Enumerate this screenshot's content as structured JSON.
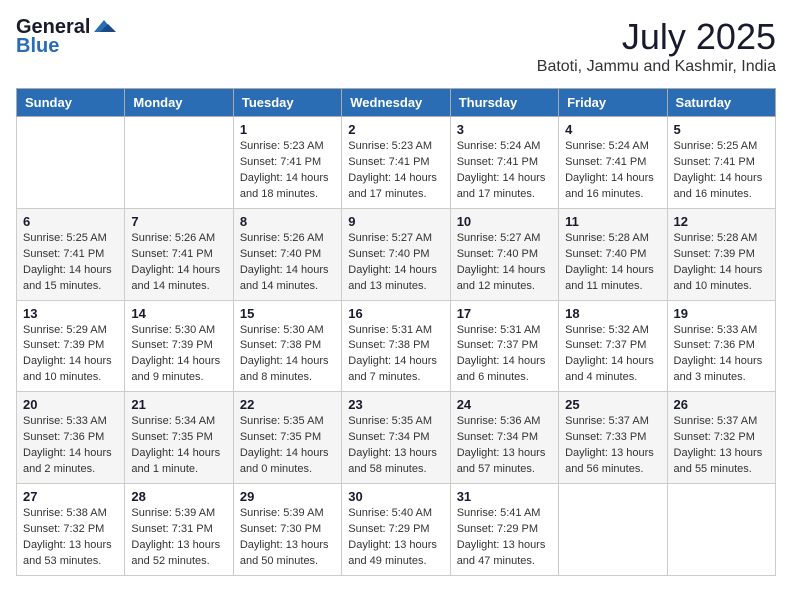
{
  "header": {
    "logo_general": "General",
    "logo_blue": "Blue",
    "month": "July 2025",
    "location": "Batoti, Jammu and Kashmir, India"
  },
  "days_of_week": [
    "Sunday",
    "Monday",
    "Tuesday",
    "Wednesday",
    "Thursday",
    "Friday",
    "Saturday"
  ],
  "weeks": [
    [
      {
        "day": "",
        "sunrise": "",
        "sunset": "",
        "daylight": ""
      },
      {
        "day": "",
        "sunrise": "",
        "sunset": "",
        "daylight": ""
      },
      {
        "day": "1",
        "sunrise": "Sunrise: 5:23 AM",
        "sunset": "Sunset: 7:41 PM",
        "daylight": "Daylight: 14 hours and 18 minutes."
      },
      {
        "day": "2",
        "sunrise": "Sunrise: 5:23 AM",
        "sunset": "Sunset: 7:41 PM",
        "daylight": "Daylight: 14 hours and 17 minutes."
      },
      {
        "day": "3",
        "sunrise": "Sunrise: 5:24 AM",
        "sunset": "Sunset: 7:41 PM",
        "daylight": "Daylight: 14 hours and 17 minutes."
      },
      {
        "day": "4",
        "sunrise": "Sunrise: 5:24 AM",
        "sunset": "Sunset: 7:41 PM",
        "daylight": "Daylight: 14 hours and 16 minutes."
      },
      {
        "day": "5",
        "sunrise": "Sunrise: 5:25 AM",
        "sunset": "Sunset: 7:41 PM",
        "daylight": "Daylight: 14 hours and 16 minutes."
      }
    ],
    [
      {
        "day": "6",
        "sunrise": "Sunrise: 5:25 AM",
        "sunset": "Sunset: 7:41 PM",
        "daylight": "Daylight: 14 hours and 15 minutes."
      },
      {
        "day": "7",
        "sunrise": "Sunrise: 5:26 AM",
        "sunset": "Sunset: 7:41 PM",
        "daylight": "Daylight: 14 hours and 14 minutes."
      },
      {
        "day": "8",
        "sunrise": "Sunrise: 5:26 AM",
        "sunset": "Sunset: 7:40 PM",
        "daylight": "Daylight: 14 hours and 14 minutes."
      },
      {
        "day": "9",
        "sunrise": "Sunrise: 5:27 AM",
        "sunset": "Sunset: 7:40 PM",
        "daylight": "Daylight: 14 hours and 13 minutes."
      },
      {
        "day": "10",
        "sunrise": "Sunrise: 5:27 AM",
        "sunset": "Sunset: 7:40 PM",
        "daylight": "Daylight: 14 hours and 12 minutes."
      },
      {
        "day": "11",
        "sunrise": "Sunrise: 5:28 AM",
        "sunset": "Sunset: 7:40 PM",
        "daylight": "Daylight: 14 hours and 11 minutes."
      },
      {
        "day": "12",
        "sunrise": "Sunrise: 5:28 AM",
        "sunset": "Sunset: 7:39 PM",
        "daylight": "Daylight: 14 hours and 10 minutes."
      }
    ],
    [
      {
        "day": "13",
        "sunrise": "Sunrise: 5:29 AM",
        "sunset": "Sunset: 7:39 PM",
        "daylight": "Daylight: 14 hours and 10 minutes."
      },
      {
        "day": "14",
        "sunrise": "Sunrise: 5:30 AM",
        "sunset": "Sunset: 7:39 PM",
        "daylight": "Daylight: 14 hours and 9 minutes."
      },
      {
        "day": "15",
        "sunrise": "Sunrise: 5:30 AM",
        "sunset": "Sunset: 7:38 PM",
        "daylight": "Daylight: 14 hours and 8 minutes."
      },
      {
        "day": "16",
        "sunrise": "Sunrise: 5:31 AM",
        "sunset": "Sunset: 7:38 PM",
        "daylight": "Daylight: 14 hours and 7 minutes."
      },
      {
        "day": "17",
        "sunrise": "Sunrise: 5:31 AM",
        "sunset": "Sunset: 7:37 PM",
        "daylight": "Daylight: 14 hours and 6 minutes."
      },
      {
        "day": "18",
        "sunrise": "Sunrise: 5:32 AM",
        "sunset": "Sunset: 7:37 PM",
        "daylight": "Daylight: 14 hours and 4 minutes."
      },
      {
        "day": "19",
        "sunrise": "Sunrise: 5:33 AM",
        "sunset": "Sunset: 7:36 PM",
        "daylight": "Daylight: 14 hours and 3 minutes."
      }
    ],
    [
      {
        "day": "20",
        "sunrise": "Sunrise: 5:33 AM",
        "sunset": "Sunset: 7:36 PM",
        "daylight": "Daylight: 14 hours and 2 minutes."
      },
      {
        "day": "21",
        "sunrise": "Sunrise: 5:34 AM",
        "sunset": "Sunset: 7:35 PM",
        "daylight": "Daylight: 14 hours and 1 minute."
      },
      {
        "day": "22",
        "sunrise": "Sunrise: 5:35 AM",
        "sunset": "Sunset: 7:35 PM",
        "daylight": "Daylight: 14 hours and 0 minutes."
      },
      {
        "day": "23",
        "sunrise": "Sunrise: 5:35 AM",
        "sunset": "Sunset: 7:34 PM",
        "daylight": "Daylight: 13 hours and 58 minutes."
      },
      {
        "day": "24",
        "sunrise": "Sunrise: 5:36 AM",
        "sunset": "Sunset: 7:34 PM",
        "daylight": "Daylight: 13 hours and 57 minutes."
      },
      {
        "day": "25",
        "sunrise": "Sunrise: 5:37 AM",
        "sunset": "Sunset: 7:33 PM",
        "daylight": "Daylight: 13 hours and 56 minutes."
      },
      {
        "day": "26",
        "sunrise": "Sunrise: 5:37 AM",
        "sunset": "Sunset: 7:32 PM",
        "daylight": "Daylight: 13 hours and 55 minutes."
      }
    ],
    [
      {
        "day": "27",
        "sunrise": "Sunrise: 5:38 AM",
        "sunset": "Sunset: 7:32 PM",
        "daylight": "Daylight: 13 hours and 53 minutes."
      },
      {
        "day": "28",
        "sunrise": "Sunrise: 5:39 AM",
        "sunset": "Sunset: 7:31 PM",
        "daylight": "Daylight: 13 hours and 52 minutes."
      },
      {
        "day": "29",
        "sunrise": "Sunrise: 5:39 AM",
        "sunset": "Sunset: 7:30 PM",
        "daylight": "Daylight: 13 hours and 50 minutes."
      },
      {
        "day": "30",
        "sunrise": "Sunrise: 5:40 AM",
        "sunset": "Sunset: 7:29 PM",
        "daylight": "Daylight: 13 hours and 49 minutes."
      },
      {
        "day": "31",
        "sunrise": "Sunrise: 5:41 AM",
        "sunset": "Sunset: 7:29 PM",
        "daylight": "Daylight: 13 hours and 47 minutes."
      },
      {
        "day": "",
        "sunrise": "",
        "sunset": "",
        "daylight": ""
      },
      {
        "day": "",
        "sunrise": "",
        "sunset": "",
        "daylight": ""
      }
    ]
  ]
}
